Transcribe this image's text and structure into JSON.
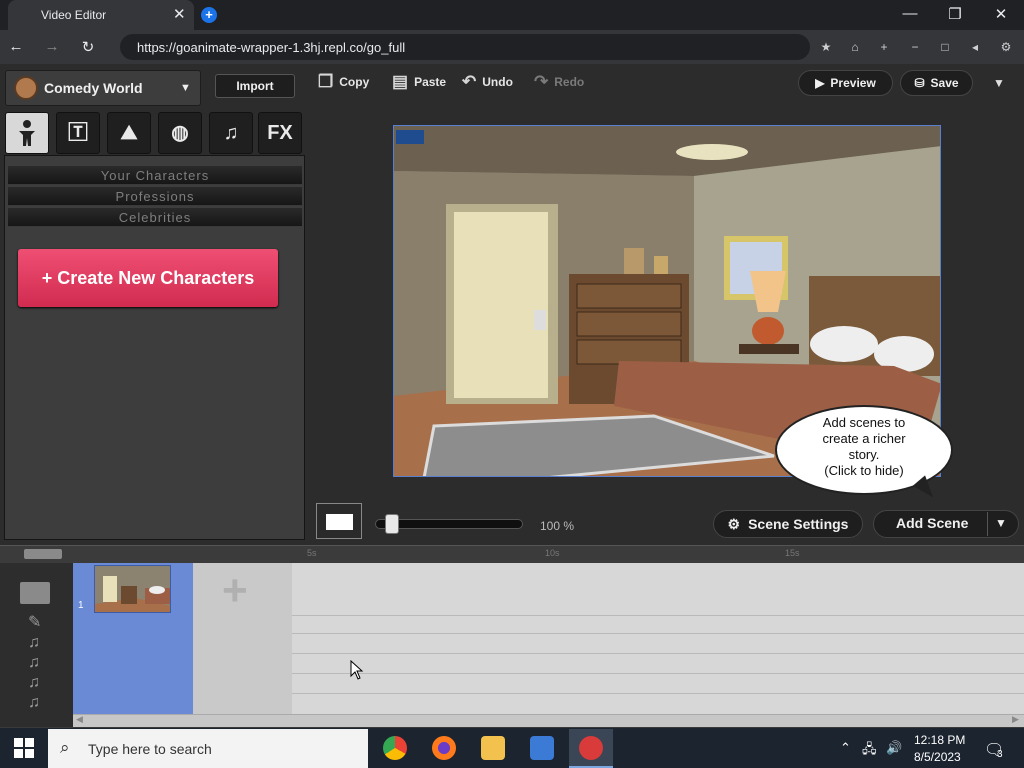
{
  "browser": {
    "tab_title": "Video Editor",
    "url": "https://goanimate-wrapper-1.3hj.repl.co/go_full"
  },
  "theme": {
    "label": "Comedy World"
  },
  "import_label": "Import",
  "category_tabs": [
    "characters-icon",
    "text-icon",
    "props-icon",
    "sports-icon",
    "music-icon",
    "FX"
  ],
  "categories": [
    "Your Characters",
    "Professions",
    "Celebrities"
  ],
  "create_label": "+ Create New Characters",
  "toolbar": {
    "copy": "Copy",
    "paste": "Paste",
    "undo": "Undo",
    "redo": "Redo",
    "preview": "Preview",
    "save": "Save"
  },
  "bubble_text": [
    "Add scenes to",
    "create a richer",
    "story.",
    "(Click to hide)"
  ],
  "zoom": "100 %",
  "scene_settings": "Scene Settings",
  "add_scene": "Add Scene",
  "timeline": {
    "ticks": [
      "5s",
      "10s",
      "15s"
    ],
    "scene_number": "1"
  },
  "taskbar": {
    "search_placeholder": "Type here to search",
    "time": "12:18 PM",
    "date": "8/5/2023",
    "notifications": "3"
  },
  "colors": {
    "accent_pink": "#e23b60",
    "scene_blue": "#6a8ad6"
  }
}
